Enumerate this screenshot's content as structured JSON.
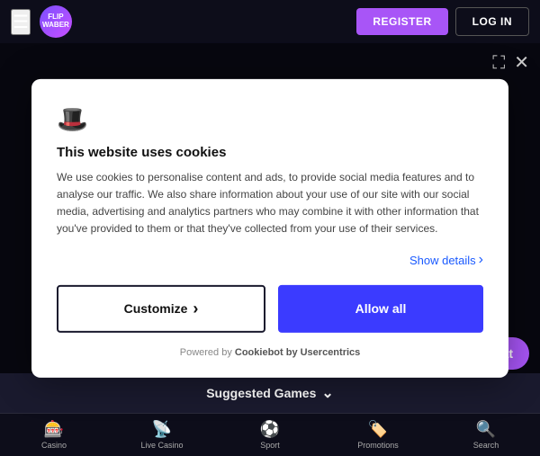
{
  "header": {
    "register_label": "REGISTER",
    "login_label": "LOG IN",
    "logo_text": "FLIP\nWABER"
  },
  "topIcons": {
    "expand_icon": "⛶",
    "close_icon": "✕"
  },
  "cookie": {
    "hat_icon": "🎩",
    "title": "This website uses cookies",
    "body": "We use cookies to personalise content and ads, to provide social media features and to analyse our traffic. We also share information about your use of our site with our social media, advertising and analytics partners who may combine it with other information that you've provided to them or that they've collected from your use of their services.",
    "show_details": "Show details",
    "customize_label": "Customize",
    "allow_all_label": "Allow all",
    "footer_text": "Powered by ",
    "footer_brand": "Cookiebot by Usercentrics"
  },
  "suggestedGames": {
    "label": "Suggested Games",
    "chevron": "⌄"
  },
  "chat": {
    "label": "Chat"
  },
  "bottomNav": {
    "items": [
      {
        "icon": "⭕",
        "label": "Casino"
      },
      {
        "icon": "📺",
        "label": "Live Casino"
      },
      {
        "icon": "⚽",
        "label": "Sport"
      },
      {
        "icon": "🏷️",
        "label": "Promotions"
      },
      {
        "icon": "🔍",
        "label": "Search"
      }
    ]
  }
}
